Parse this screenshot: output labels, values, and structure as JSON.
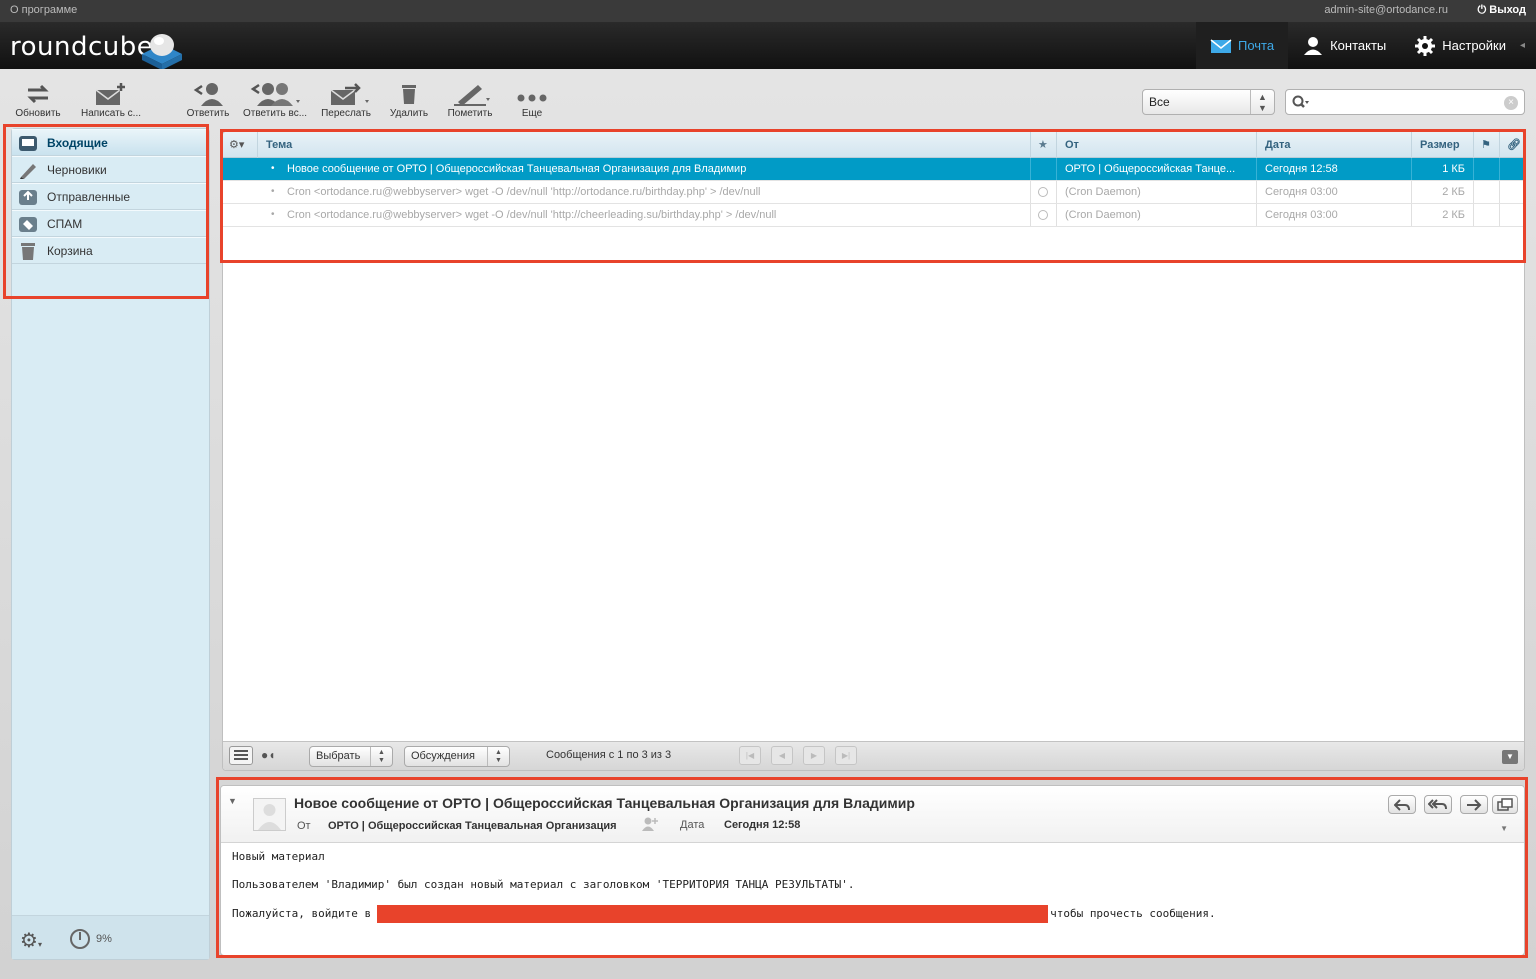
{
  "topline": {
    "about": "О программе",
    "user": "admin-site@ortodance.ru",
    "logout": "Выход"
  },
  "header": {
    "logo_text": "roundcube",
    "tasks": [
      {
        "label": "Почта",
        "icon": "mail-icon",
        "active": true
      },
      {
        "label": "Контакты",
        "icon": "contacts-icon",
        "active": false
      },
      {
        "label": "Настройки",
        "icon": "settings-gear-icon",
        "active": false
      }
    ]
  },
  "toolbar": {
    "refresh": "Обновить",
    "compose": "Написать с...",
    "reply": "Ответить",
    "reply_all": "Ответить вс...",
    "forward": "Переслать",
    "delete": "Удалить",
    "mark": "Пометить",
    "more": "Еще"
  },
  "filter": {
    "selected": "Все"
  },
  "search": {
    "placeholder": ""
  },
  "folders": [
    {
      "label": "Входящие",
      "icon": "inbox-icon",
      "selected": true
    },
    {
      "label": "Черновики",
      "icon": "drafts-pencil-icon",
      "selected": false
    },
    {
      "label": "Отправленные",
      "icon": "sent-icon",
      "selected": false
    },
    {
      "label": "СПАМ",
      "icon": "spam-icon",
      "selected": false
    },
    {
      "label": "Корзина",
      "icon": "trash-icon",
      "selected": false
    }
  ],
  "quota": {
    "value": "9%"
  },
  "list": {
    "columns": {
      "subject": "Тема",
      "from": "От",
      "date": "Дата",
      "size": "Размер"
    },
    "rows": [
      {
        "subject": "Новое сообщение от ОРТО | Общероссийская Танцевальная Организация для Владимир",
        "from": "ОРТО | Общероссийская Танце...",
        "date": "Сегодня 12:58",
        "size": "1 КБ",
        "selected": true
      },
      {
        "subject": "Cron <ortodance.ru@webbyserver> wget -O /dev/null 'http://ortodance.ru/birthday.php' > /dev/null",
        "from": "(Cron Daemon)",
        "date": "Сегодня 03:00",
        "size": "2 КБ",
        "selected": false
      },
      {
        "subject": "Cron <ortodance.ru@webbyserver> wget -O /dev/null 'http://cheerleading.su/birthday.php' > /dev/null",
        "from": "(Cron Daemon)",
        "date": "Сегодня 03:00",
        "size": "2 КБ",
        "selected": false
      }
    ],
    "footer": {
      "select": "Выбрать",
      "threads": "Обсуждения",
      "count": "Сообщения с 1 по 3 из 3"
    }
  },
  "preview": {
    "subject": "Новое сообщение от ОРТО | Общероссийская Танцевальная Организация для Владимир",
    "from_label": "От",
    "from_value": "ОРТО | Общероссийская Танцевальная Организация",
    "date_label": "Дата",
    "date_value": "Сегодня 12:58",
    "body": {
      "line1": "Новый материал",
      "line2": "Пользователем 'Владимир' был создан новый материал с заголовком 'ТЕРРИТОРИЯ ТАНЦА РЕЗУЛЬТАТЫ'.",
      "line3_start": "Пожалуйста, войдите в",
      "line3_end": "чтобы прочесть сообщения."
    }
  },
  "colors": {
    "selection": "#019bc6",
    "annotation": "#e8432b",
    "active_task": "#3ea9e8"
  }
}
